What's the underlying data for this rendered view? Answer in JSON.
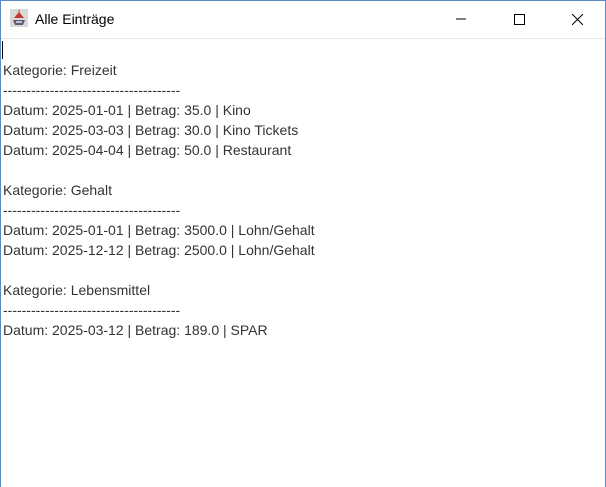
{
  "window": {
    "title": "Alle Einträge",
    "app_icon": "java-cup-icon",
    "controls": [
      "minimize-icon",
      "maximize-icon",
      "close-icon"
    ]
  },
  "content": {
    "lines": [
      "Kategorie: Freizeit",
      "--------------------------------------",
      "Datum: 2025-01-01 | Betrag: 35.0 | Kino",
      "Datum: 2025-03-03 | Betrag: 30.0 | Kino Tickets",
      "Datum: 2025-04-04 | Betrag: 50.0 | Restaurant",
      "",
      "Kategorie: Gehalt",
      "--------------------------------------",
      "Datum: 2025-01-01 | Betrag: 3500.0 | Lohn/Gehalt",
      "Datum: 2025-12-12 | Betrag: 2500.0 | Lohn/Gehalt",
      "",
      "Kategorie: Lebensmittel",
      "--------------------------------------",
      "Datum: 2025-03-12 | Betrag: 189.0 | SPAR"
    ]
  }
}
